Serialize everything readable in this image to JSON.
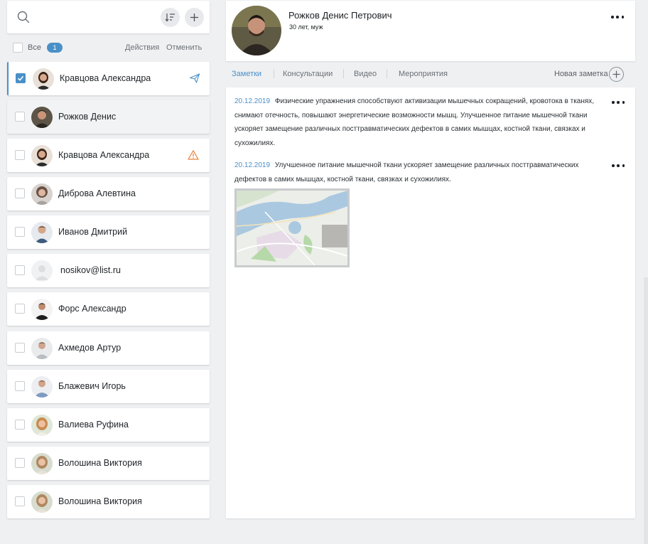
{
  "search": {
    "icon": "search-icon",
    "sort_icon": "sort-icon",
    "add_icon": "plus-icon"
  },
  "selection": {
    "all_label": "Все",
    "count": "1",
    "actions_label": "Действия",
    "cancel_label": "Отменить"
  },
  "contacts": [
    {
      "name": "Кравцова Александра",
      "checked": true,
      "status": "send-icon",
      "avatar_color": "#8a5a44"
    },
    {
      "name": "Рожков Денис",
      "checked": false,
      "status": "",
      "avatar_color": "#4a4136"
    },
    {
      "name": "Кравцова Александра",
      "checked": false,
      "status": "warning-icon",
      "avatar_color": "#8a5a44"
    },
    {
      "name": "Диброва Алевтина",
      "checked": false,
      "status": "",
      "avatar_color": "#7c6e6a"
    },
    {
      "name": "Иванов Дмитрий",
      "checked": false,
      "status": "",
      "avatar_color": "#5b6b7c"
    },
    {
      "name": "nosikov@list.ru",
      "checked": false,
      "status": "",
      "avatar_color": "#e8e9ec"
    },
    {
      "name": "Форс Александр",
      "checked": false,
      "status": "",
      "avatar_color": "#2f2f31"
    },
    {
      "name": "Ахмедов Артур",
      "checked": false,
      "status": "",
      "avatar_color": "#9aa0a6"
    },
    {
      "name": "Блажевич Игорь",
      "checked": false,
      "status": "",
      "avatar_color": "#7f93ad"
    },
    {
      "name": "Валиева Руфина",
      "checked": false,
      "status": "",
      "avatar_color": "#c98f5e"
    },
    {
      "name": "Волошина Виктория",
      "checked": false,
      "status": "",
      "avatar_color": "#b79a7a"
    },
    {
      "name": "Волошина Виктория",
      "checked": false,
      "status": "",
      "avatar_color": "#b79a7a"
    }
  ],
  "profile": {
    "name": "Рожков Денис Петрович",
    "meta": "30 лет, муж"
  },
  "tabs": [
    {
      "label": "Заметки",
      "active": true
    },
    {
      "label": "Консультации",
      "active": false
    },
    {
      "label": "Видео",
      "active": false
    },
    {
      "label": "Мероприятия",
      "active": false
    }
  ],
  "new_note_label": "Новая заметка",
  "notes": [
    {
      "date": "20.12.2019",
      "lines": [
        "Физические упражнения способствуют активизации мышечных сокращений, кровотока в тканях,",
        "снимают отечность, повышают энергетические возможности мышц. Улучшенное питание мышечной ткани",
        "ускоряет замещение различных посттравматических дефектов в самих мышцах, костной ткани, связках и",
        "сухожилиях."
      ]
    },
    {
      "date": "20.12.2019",
      "lines": [
        "Улучшенное питание мышечной ткани ускоряет замещение различных посттравматических",
        "дефектов в самих мышцах, костной ткани, связках и сухожилиях."
      ],
      "attachment": "map-image"
    }
  ],
  "colors": {
    "accent": "#4a90c8",
    "warning": "#e8833a",
    "background": "#eff0f2"
  }
}
